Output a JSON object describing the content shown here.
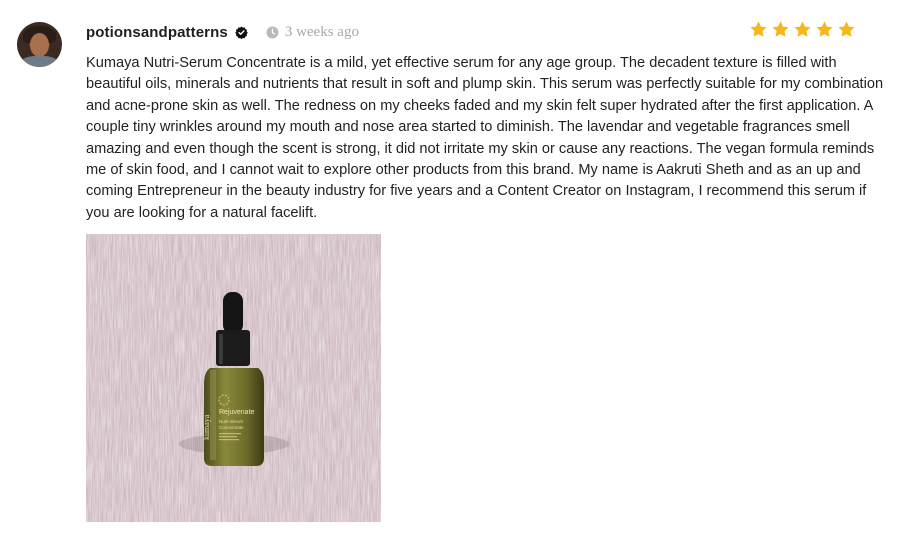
{
  "review": {
    "username": "potionsandpatterns",
    "time_ago": "3 weeks ago",
    "rating": 5,
    "rating_max": 5,
    "star_color": "#f5b81c",
    "body": "Kumaya Nutri-Serum Concentrate is a mild, yet effective serum for any age group. The decadent texture is filled with beautiful oils, minerals and nutrients that result in soft and plump skin. This serum was perfectly suitable for my combination and acne-prone skin as well. The redness on my cheeks faded and my skin felt super hydrated after the first application. A couple tiny wrinkles around my mouth and nose area started to diminish. The lavendar and vegetable fragrances smell amazing and even though the scent is strong, it did not irritate my skin or cause any reactions. The vegan formula reminds me of skin food, and I cannot wait to explore other products from this brand. My name is Aakruti Sheth and as an up and coming Entrepreneur in the beauty industry for five years and a Content Creator on Instagram, I recommend this serum if you are looking for a natural facelift.",
    "photo": {
      "label_brand": "kumaya",
      "label_name": "Rejuvenate",
      "label_line1": "Nutri-Serum",
      "label_line2": "Concentrate"
    }
  }
}
